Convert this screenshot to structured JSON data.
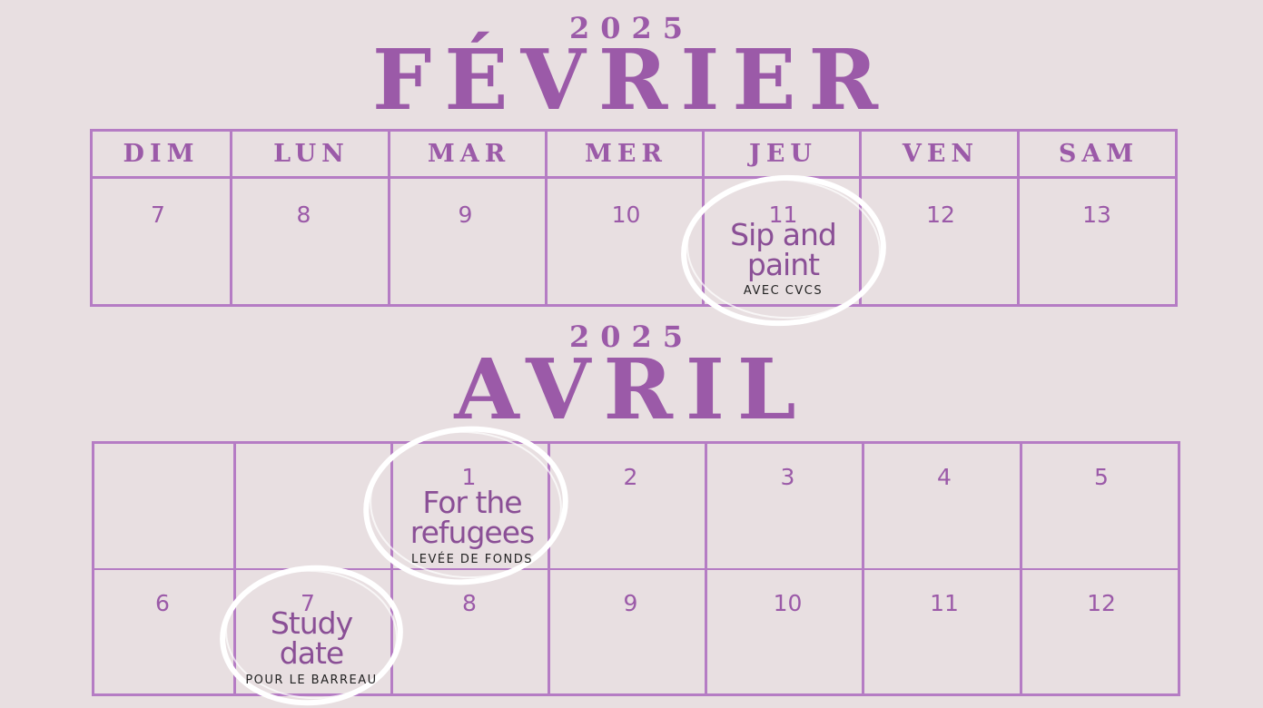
{
  "february": {
    "year": "2025",
    "month": "FÉVRIER",
    "daynames": [
      "DIM",
      "LUN",
      "MAR",
      "MER",
      "JEU",
      "VEN",
      "SAM"
    ],
    "days": [
      "7",
      "8",
      "9",
      "10",
      "11",
      "12",
      "13"
    ],
    "event": {
      "title_line1": "Sip and",
      "title_line2": "paint",
      "subtitle": "AVEC CVCS"
    }
  },
  "april": {
    "year": "2025",
    "month": "AVRIL",
    "week1": [
      "",
      "",
      "1",
      "2",
      "3",
      "4",
      "5"
    ],
    "week2": [
      "6",
      "7",
      "8",
      "9",
      "10",
      "11",
      "12"
    ],
    "event1": {
      "title_line1": "For the",
      "title_line2": "refugees",
      "subtitle": "LEVÉE DE FONDS"
    },
    "event2": {
      "title_line1": "Study",
      "title_line2": "date",
      "subtitle": "POUR LE BARREAU"
    }
  },
  "colors": {
    "background": "#e8dfe1",
    "accent": "#9b5aa8",
    "grid": "#b57cc4",
    "circle": "#ffffff"
  }
}
